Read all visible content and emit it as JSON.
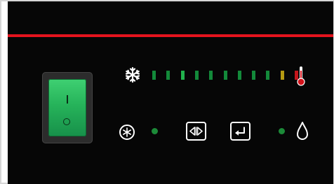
{
  "power_switch": {
    "on_mark": "I",
    "off_mark": "O",
    "state": "on",
    "color": "#26b35a"
  },
  "temperature_bar": {
    "cold_icon": "snowflake-icon",
    "hot_icon": "thermometer-icon",
    "segments": [
      {
        "color": "#138a3a",
        "lit": true
      },
      {
        "color": "#138a3a",
        "lit": true
      },
      {
        "color": "#22b24c",
        "lit": true
      },
      {
        "color": "#138a3a",
        "lit": true
      },
      {
        "color": "#138a3a",
        "lit": true
      },
      {
        "color": "#138a3a",
        "lit": true
      },
      {
        "color": "#138a3a",
        "lit": true
      },
      {
        "color": "#138a3a",
        "lit": true
      },
      {
        "color": "#138a3a",
        "lit": true
      },
      {
        "color": "#b59a12",
        "lit": true
      },
      {
        "color": "#c4161c",
        "lit": true
      }
    ]
  },
  "controls": {
    "compressor": {
      "icon": "compressor-icon",
      "led_color": "#1c8a38"
    },
    "manual_defrost_button": {
      "icon": "arrows-left-right-icon"
    },
    "enter_button": {
      "icon": "enter-return-icon"
    },
    "drip": {
      "led_color": "#1c8a38",
      "icon": "water-drop-icon"
    }
  },
  "colors": {
    "panel": "#060606",
    "accent_red": "#e3131d",
    "icon": "#ffffff"
  }
}
